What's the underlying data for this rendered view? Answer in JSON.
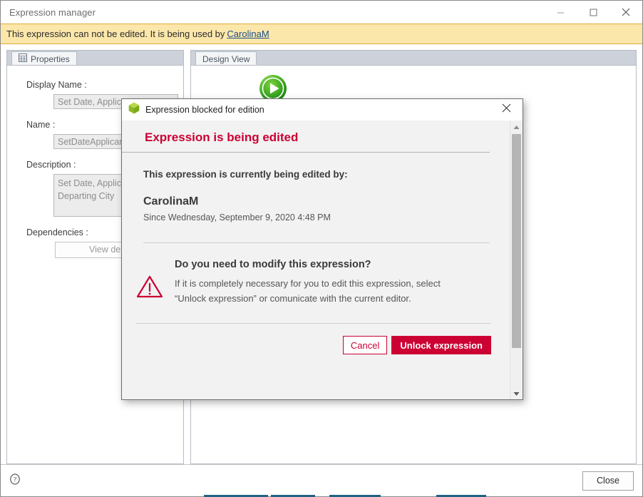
{
  "window": {
    "title": "Expression manager",
    "controls": {
      "minimize": "minimize-icon",
      "maximize": "maximize-icon",
      "close": "close-icon"
    }
  },
  "banner": {
    "text": "This expression can not be edited. It is being used by",
    "link_user": "CarolinaM",
    "background": "#fce7ab",
    "border": "#e0a93a"
  },
  "properties_panel": {
    "tab_label": "Properties",
    "tab_icon": "properties-grid-icon",
    "fields": {
      "display_name": {
        "label": "Display Name :",
        "value": "Set Date, Applicant"
      },
      "name": {
        "label": "Name :",
        "value": "SetDateApplicantCit"
      },
      "description": {
        "label": "Description :",
        "value": "Set Date, Applicant\nDeparting City"
      },
      "dependencies": {
        "label": "Dependencies :",
        "button_label": "View depende"
      }
    }
  },
  "design_panel": {
    "tab_label": "Design View",
    "start_node_icon": "green-play-start-icon"
  },
  "footer": {
    "help_icon": "help-question-icon",
    "close_label": "Close"
  },
  "dialog": {
    "title": "Expression blocked for edition",
    "title_icon": "green-hexagon-icon",
    "close_icon": "close-icon",
    "heading": "Expression is being edited",
    "heading_color": "#cc0033",
    "editor_intro": "This expression is currently being edited by:",
    "editor_name": "CarolinaM",
    "editor_since": "Since Wednesday, September 9, 2020 4:48 PM",
    "warning_icon": "warning-triangle-icon",
    "warning_question": "Do you need to modify this expression?",
    "warning_body_line1": "If it is completely necessary for you to edit this expression, select",
    "warning_body_line2": "“Unlock expression” or comunicate with the current editor.",
    "buttons": {
      "cancel": "Cancel",
      "unlock": "Unlock expression"
    },
    "scrollbar": {
      "up_arrow": "scroll-up-arrow-icon",
      "down_arrow": "scroll-down-arrow-icon"
    },
    "accent_color": "#cc0033"
  },
  "taskbar_hints": {
    "accent": "#1f6383"
  }
}
